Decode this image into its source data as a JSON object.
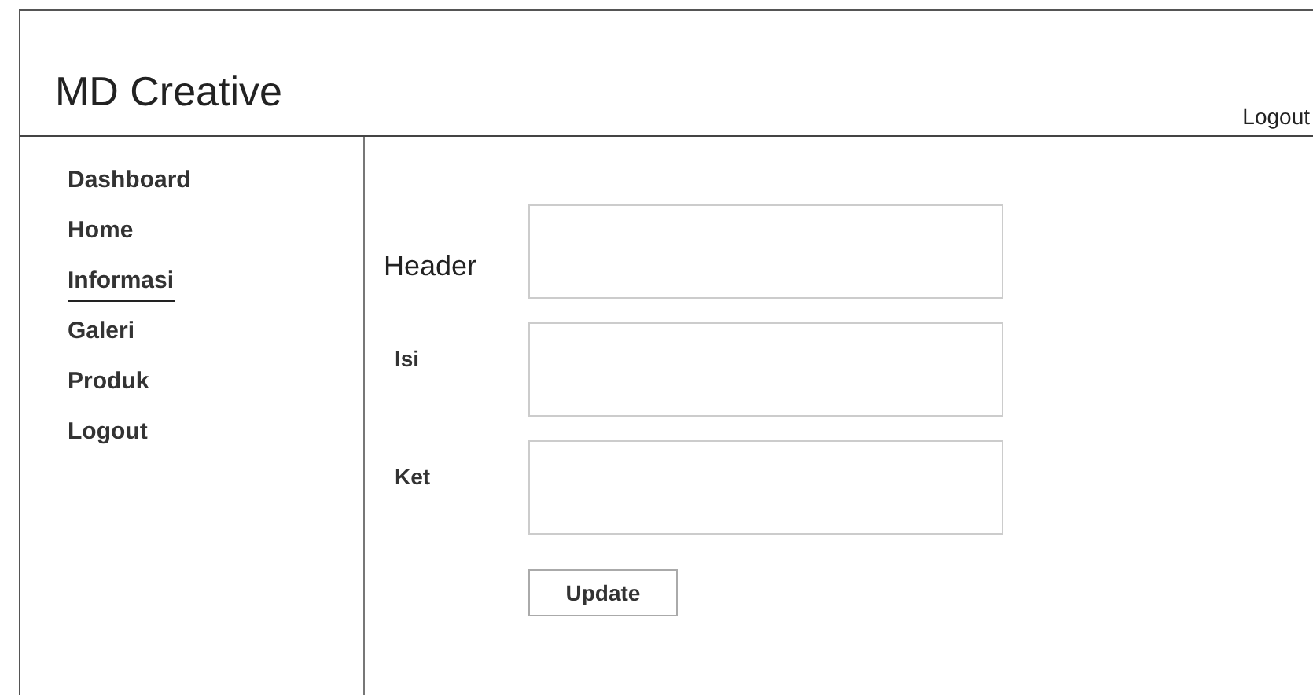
{
  "header": {
    "title": "MD Creative",
    "logout": "Logout"
  },
  "sidebar": {
    "items": [
      {
        "label": "Dashboard",
        "selected": false
      },
      {
        "label": "Home",
        "selected": false
      },
      {
        "label": "Informasi",
        "selected": true
      },
      {
        "label": "Galeri",
        "selected": false
      },
      {
        "label": "Produk",
        "selected": false
      },
      {
        "label": "Logout",
        "selected": false
      }
    ]
  },
  "form": {
    "fields": [
      {
        "label": "Header",
        "bold": false
      },
      {
        "label": "Isi",
        "bold": true
      },
      {
        "label": "Ket",
        "bold": true
      }
    ],
    "button": "Update"
  }
}
